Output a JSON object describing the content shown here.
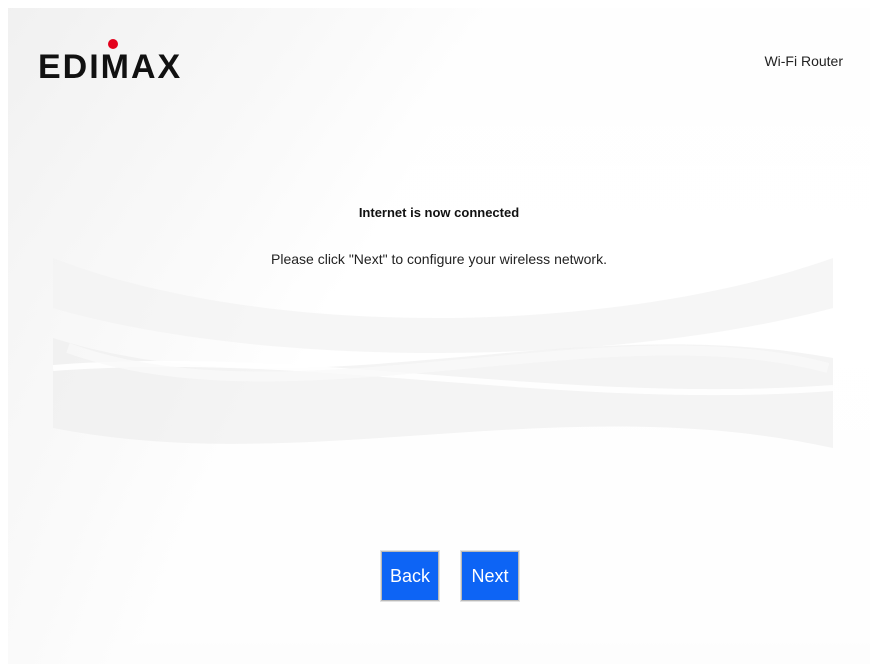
{
  "header": {
    "brand": "EDIMAX",
    "product": "Wi-Fi Router"
  },
  "main": {
    "headline": "Internet is now connected",
    "message": "Please click \"Next\" to configure your wireless network."
  },
  "buttons": {
    "back_label": "Back",
    "next_label": "Next"
  },
  "colors": {
    "button_blue": "#0d64f5",
    "brand_black": "#111111",
    "brand_red": "#e3001b"
  }
}
